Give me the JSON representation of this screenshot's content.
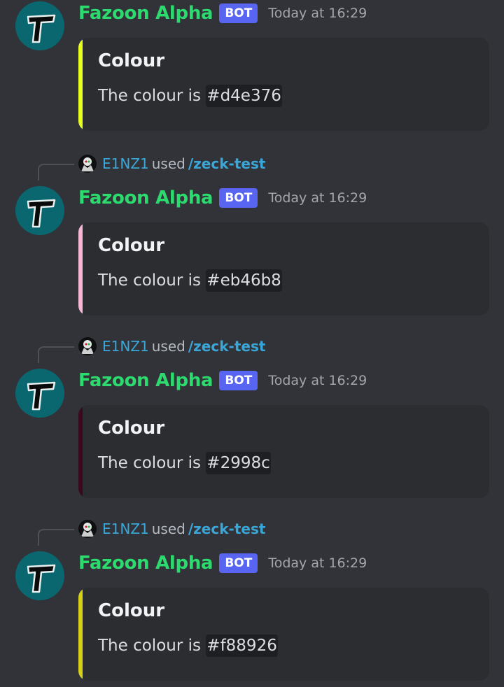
{
  "bot": {
    "name": "Fazoon Alpha",
    "tag": "BOT"
  },
  "messages": [
    {
      "timestamp": "Today at 16:29",
      "embed_title": "Colour",
      "embed_desc": "The colour is ",
      "color_code": "#d4e376",
      "bar_color": "#e7ff1f"
    },
    {
      "reply": {
        "user": "E1NZ1",
        "used": "used",
        "command": "/zeck-test"
      },
      "timestamp": "Today at 16:29",
      "embed_title": "Colour",
      "embed_desc": "The colour is ",
      "color_code": "#eb46b8",
      "bar_color": "#f7b6d6"
    },
    {
      "reply": {
        "user": "E1NZ1",
        "used": "used",
        "command": "/zeck-test"
      },
      "timestamp": "Today at 16:29",
      "embed_title": "Colour",
      "embed_desc": "The colour is ",
      "color_code": "#2998c",
      "bar_color": "#3a0a1c"
    },
    {
      "reply": {
        "user": "E1NZ1",
        "used": "used",
        "command": "/zeck-test"
      },
      "timestamp": "Today at 16:29",
      "embed_title": "Colour",
      "embed_desc": "The colour is ",
      "color_code": "#f88926",
      "bar_color": "#d6d017"
    }
  ]
}
